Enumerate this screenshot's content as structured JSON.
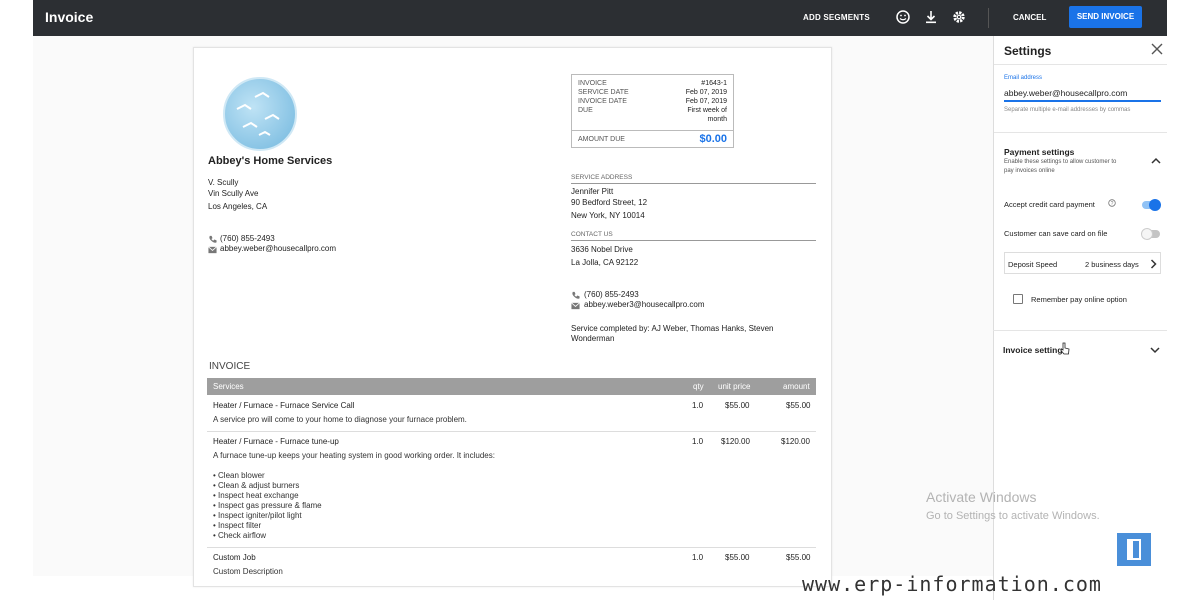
{
  "appbar": {
    "title": "Invoice",
    "add_segments": "ADD SEGMENTS",
    "icons": [
      "smiley-icon",
      "download-icon",
      "gear-icon"
    ],
    "cancel": "CANCEL",
    "send_invoice": "SEND INVOICE"
  },
  "business": {
    "name": "Abbey's Home Services",
    "contact_name": "V. Scully",
    "street": "Vin Scully Ave",
    "city": "Los Angeles, CA",
    "phone": "(760) 855-2493",
    "email": "abbey.weber@housecallpro.com"
  },
  "meta": {
    "rows": [
      {
        "label": "INVOICE",
        "value": "#1643-1"
      },
      {
        "label": "SERVICE DATE",
        "value": "Feb 07, 2019"
      },
      {
        "label": "INVOICE DATE",
        "value": "Feb 07, 2019"
      },
      {
        "label": "DUE",
        "value": "First week of"
      },
      {
        "label": "",
        "value": "month"
      }
    ],
    "amount_due_label": "AMOUNT DUE",
    "amount_due": "$0.00"
  },
  "service_address": {
    "label": "SERVICE ADDRESS",
    "name": "Jennifer Pitt",
    "street": "90 Bedford Street, 12",
    "city": "New York, NY 10014"
  },
  "contact": {
    "label": "CONTACT US",
    "street": "3636 Nobel Drive",
    "city": "La Jolla, CA 92122",
    "phone": "(760) 855-2493",
    "email": "abbey.weber3@housecallpro.com",
    "completed_by_line1": "Service completed by: AJ Weber, Thomas Hanks, Steven",
    "completed_by_line2": "Wonderman"
  },
  "invoice": {
    "heading": "INVOICE",
    "columns": {
      "services": "Services",
      "qty": "qty",
      "unit_price": "unit price",
      "amount": "amount"
    },
    "items": [
      {
        "name": "Heater / Furnace - Furnace Service Call",
        "qty": "1.0",
        "unit_price": "$55.00",
        "amount": "$55.00",
        "description": "A service pro will come to your home to diagnose your furnace problem.",
        "bullets": []
      },
      {
        "name": "Heater / Furnace - Furnace tune-up",
        "qty": "1.0",
        "unit_price": "$120.00",
        "amount": "$120.00",
        "description": "A furnace tune-up keeps your heating system in good working order. It includes:",
        "bullets": [
          "• Clean blower",
          "• Clean & adjust burners",
          "• Inspect heat exchange",
          "• Inspect gas pressure & flame",
          "• Inspect igniter/pilot light",
          "• Inspect filter",
          "• Check airflow"
        ]
      },
      {
        "name": "Custom Job",
        "qty": "1.0",
        "unit_price": "$55.00",
        "amount": "$55.00",
        "description": "Custom Description",
        "bullets": []
      }
    ]
  },
  "settings": {
    "title": "Settings",
    "email_label": "Email address",
    "email_value": "abbey.weber@housecallpro.com",
    "email_hint": "Separate multiple e-mail addresses by commas",
    "payment_title": "Payment settings",
    "payment_desc_1": "Enable these settings to allow customer to",
    "payment_desc_2": "pay invoices online",
    "accept_cc": "Accept credit card payment",
    "accept_cc_on": true,
    "save_card": "Customer can save card on file",
    "save_card_on": false,
    "deposit_label": "Deposit Speed",
    "deposit_value": "2 business days",
    "remember": "Remember pay online option",
    "invoice_settings": "Invoice settings"
  },
  "watermark": {
    "line1": "Activate Windows",
    "line2": "Go to Settings to activate Windows.",
    "site": "www.erp-information.com"
  },
  "colors": {
    "accent": "#1a73e8",
    "appbar": "#2c2f33",
    "table_header": "#9e9e9e"
  }
}
